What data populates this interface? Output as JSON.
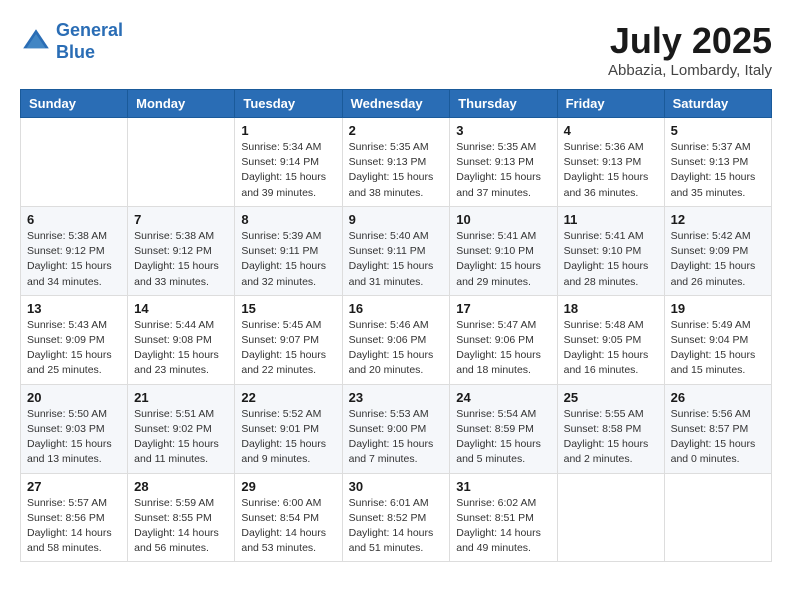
{
  "header": {
    "logo_line1": "General",
    "logo_line2": "Blue",
    "month_title": "July 2025",
    "location": "Abbazia, Lombardy, Italy"
  },
  "weekdays": [
    "Sunday",
    "Monday",
    "Tuesday",
    "Wednesday",
    "Thursday",
    "Friday",
    "Saturday"
  ],
  "weeks": [
    [
      {
        "day": "",
        "detail": ""
      },
      {
        "day": "",
        "detail": ""
      },
      {
        "day": "1",
        "detail": "Sunrise: 5:34 AM\nSunset: 9:14 PM\nDaylight: 15 hours\nand 39 minutes."
      },
      {
        "day": "2",
        "detail": "Sunrise: 5:35 AM\nSunset: 9:13 PM\nDaylight: 15 hours\nand 38 minutes."
      },
      {
        "day": "3",
        "detail": "Sunrise: 5:35 AM\nSunset: 9:13 PM\nDaylight: 15 hours\nand 37 minutes."
      },
      {
        "day": "4",
        "detail": "Sunrise: 5:36 AM\nSunset: 9:13 PM\nDaylight: 15 hours\nand 36 minutes."
      },
      {
        "day": "5",
        "detail": "Sunrise: 5:37 AM\nSunset: 9:13 PM\nDaylight: 15 hours\nand 35 minutes."
      }
    ],
    [
      {
        "day": "6",
        "detail": "Sunrise: 5:38 AM\nSunset: 9:12 PM\nDaylight: 15 hours\nand 34 minutes."
      },
      {
        "day": "7",
        "detail": "Sunrise: 5:38 AM\nSunset: 9:12 PM\nDaylight: 15 hours\nand 33 minutes."
      },
      {
        "day": "8",
        "detail": "Sunrise: 5:39 AM\nSunset: 9:11 PM\nDaylight: 15 hours\nand 32 minutes."
      },
      {
        "day": "9",
        "detail": "Sunrise: 5:40 AM\nSunset: 9:11 PM\nDaylight: 15 hours\nand 31 minutes."
      },
      {
        "day": "10",
        "detail": "Sunrise: 5:41 AM\nSunset: 9:10 PM\nDaylight: 15 hours\nand 29 minutes."
      },
      {
        "day": "11",
        "detail": "Sunrise: 5:41 AM\nSunset: 9:10 PM\nDaylight: 15 hours\nand 28 minutes."
      },
      {
        "day": "12",
        "detail": "Sunrise: 5:42 AM\nSunset: 9:09 PM\nDaylight: 15 hours\nand 26 minutes."
      }
    ],
    [
      {
        "day": "13",
        "detail": "Sunrise: 5:43 AM\nSunset: 9:09 PM\nDaylight: 15 hours\nand 25 minutes."
      },
      {
        "day": "14",
        "detail": "Sunrise: 5:44 AM\nSunset: 9:08 PM\nDaylight: 15 hours\nand 23 minutes."
      },
      {
        "day": "15",
        "detail": "Sunrise: 5:45 AM\nSunset: 9:07 PM\nDaylight: 15 hours\nand 22 minutes."
      },
      {
        "day": "16",
        "detail": "Sunrise: 5:46 AM\nSunset: 9:06 PM\nDaylight: 15 hours\nand 20 minutes."
      },
      {
        "day": "17",
        "detail": "Sunrise: 5:47 AM\nSunset: 9:06 PM\nDaylight: 15 hours\nand 18 minutes."
      },
      {
        "day": "18",
        "detail": "Sunrise: 5:48 AM\nSunset: 9:05 PM\nDaylight: 15 hours\nand 16 minutes."
      },
      {
        "day": "19",
        "detail": "Sunrise: 5:49 AM\nSunset: 9:04 PM\nDaylight: 15 hours\nand 15 minutes."
      }
    ],
    [
      {
        "day": "20",
        "detail": "Sunrise: 5:50 AM\nSunset: 9:03 PM\nDaylight: 15 hours\nand 13 minutes."
      },
      {
        "day": "21",
        "detail": "Sunrise: 5:51 AM\nSunset: 9:02 PM\nDaylight: 15 hours\nand 11 minutes."
      },
      {
        "day": "22",
        "detail": "Sunrise: 5:52 AM\nSunset: 9:01 PM\nDaylight: 15 hours\nand 9 minutes."
      },
      {
        "day": "23",
        "detail": "Sunrise: 5:53 AM\nSunset: 9:00 PM\nDaylight: 15 hours\nand 7 minutes."
      },
      {
        "day": "24",
        "detail": "Sunrise: 5:54 AM\nSunset: 8:59 PM\nDaylight: 15 hours\nand 5 minutes."
      },
      {
        "day": "25",
        "detail": "Sunrise: 5:55 AM\nSunset: 8:58 PM\nDaylight: 15 hours\nand 2 minutes."
      },
      {
        "day": "26",
        "detail": "Sunrise: 5:56 AM\nSunset: 8:57 PM\nDaylight: 15 hours\nand 0 minutes."
      }
    ],
    [
      {
        "day": "27",
        "detail": "Sunrise: 5:57 AM\nSunset: 8:56 PM\nDaylight: 14 hours\nand 58 minutes."
      },
      {
        "day": "28",
        "detail": "Sunrise: 5:59 AM\nSunset: 8:55 PM\nDaylight: 14 hours\nand 56 minutes."
      },
      {
        "day": "29",
        "detail": "Sunrise: 6:00 AM\nSunset: 8:54 PM\nDaylight: 14 hours\nand 53 minutes."
      },
      {
        "day": "30",
        "detail": "Sunrise: 6:01 AM\nSunset: 8:52 PM\nDaylight: 14 hours\nand 51 minutes."
      },
      {
        "day": "31",
        "detail": "Sunrise: 6:02 AM\nSunset: 8:51 PM\nDaylight: 14 hours\nand 49 minutes."
      },
      {
        "day": "",
        "detail": ""
      },
      {
        "day": "",
        "detail": ""
      }
    ]
  ]
}
